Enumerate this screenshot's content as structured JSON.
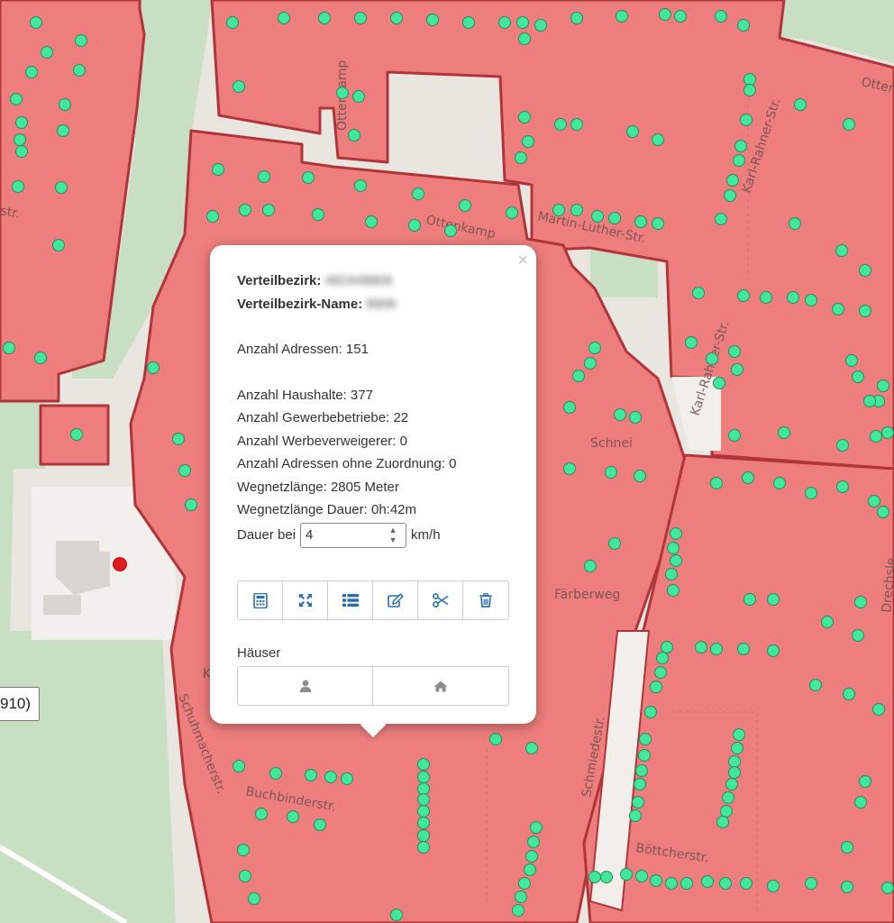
{
  "map": {
    "street_labels": [
      "Ottenkamp",
      "Ottenkamp",
      "Martin-Luther-Str.",
      "Karl-Rahner-Str.",
      "Karl-Rahner-Str.",
      "Otten",
      "str.",
      "Schnei",
      "Färberweg",
      "Schuhmacherstr.",
      "Buchbinderstr.",
      "Schmiedestr.",
      "Böttcherstr.",
      "Drechsle",
      "K"
    ],
    "marker_label": "910)",
    "colors": {
      "district_fill": "#ee7e7d",
      "district_border": "#b0353a",
      "house_point": "#3fe89a",
      "selected_marker": "#e01b1b",
      "park": "#c9dfc4"
    }
  },
  "popup": {
    "close_label": "×",
    "district_label": "Verteilbezirk:",
    "district_value": "482448806",
    "district_name_label": "Verteilbezirk-Name:",
    "district_name_value": "8906",
    "addresses": "Anzahl Adressen: 151",
    "households": "Anzahl Haushalte: 377",
    "businesses": "Anzahl Gewerbebetriebe: 22",
    "ad_refusers": "Anzahl Werbeverweigerer: 0",
    "unassigned": "Anzahl Adressen ohne Zuordnung: 0",
    "road_length": "Wegnetzlänge: 2805 Meter",
    "road_duration": "Wegnetzlänge Dauer: 0h:42m",
    "speed_prefix": "Dauer bei",
    "speed_value": "4",
    "speed_unit": "km/h",
    "toolbar_icons": [
      "calculator-icon",
      "expand-icon",
      "list-icon",
      "edit-icon",
      "scissors-icon",
      "trash-icon"
    ],
    "houses_title": "Häuser",
    "houses_buttons": [
      "person-icon",
      "home-icon"
    ],
    "icon_color": "#2a6fa8"
  }
}
